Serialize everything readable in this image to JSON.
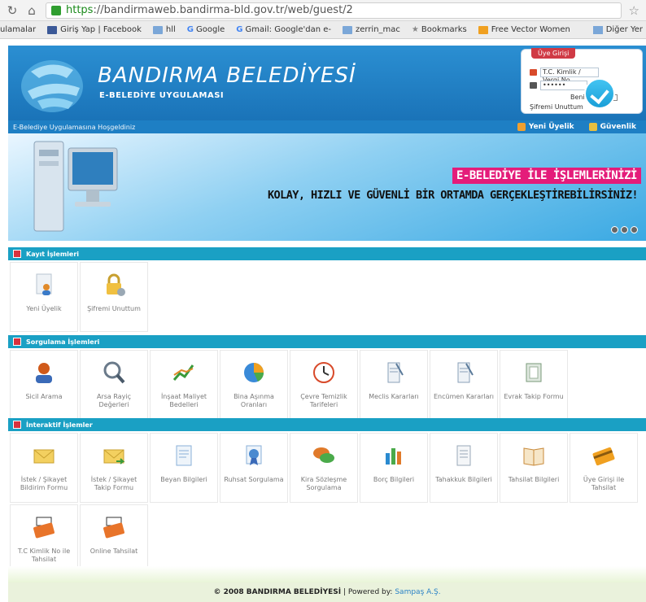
{
  "browser": {
    "nav_icons": [
      "back-icon",
      "home-icon"
    ],
    "url_https": "https",
    "url_rest": "://bandirmaweb.bandirma-bld.gov.tr/web/guest/2",
    "bookmarks": [
      {
        "label": "ulamalar",
        "color": "#f3f3f3"
      },
      {
        "label": "Giriş Yap | Facebook",
        "color": "#3b5998"
      },
      {
        "label": "hll",
        "color": "#7ba7d8"
      },
      {
        "label": "Google",
        "color": "#4285f4"
      },
      {
        "label": "Gmail: Google'dan e-",
        "color": "#4285f4"
      },
      {
        "label": "zerrin_mac",
        "color": "#7ba7d8"
      },
      {
        "label": "Bookmarks",
        "color": "#999999"
      },
      {
        "label": "Free Vector Women",
        "color": "#f0a020"
      }
    ],
    "bookmarks_other": "Diğer Yer"
  },
  "header": {
    "title": "BANDIRMA BELEDİYESİ",
    "subtitle": "E-BELEDİYE UYGULAMASI"
  },
  "login": {
    "tab": "Üye Girişi",
    "tc_label": "T.C. Kimlik / Vergi No",
    "password_value": "••••••",
    "remember_label": "Beni Hatırla",
    "forgot_label": "Şifremi Unuttum"
  },
  "nav": {
    "welcome": "E-Belediye Uygulamasına Hoşgeldiniz",
    "new_member": "Yeni Üyelik",
    "security": "Güvenlik"
  },
  "banner": {
    "headline": "E-BELEDİYE İLE İŞLEMLERİNİZİ",
    "tagline": "KOLAY, HIZLI VE GÜVENLİ BİR ORTAMDA GERÇEKLEŞTİREBİLİRSİNİZ!"
  },
  "sections": [
    {
      "title": "Kayıt İşlemleri",
      "items": [
        {
          "label": "Yeni Üyelik",
          "icon": "new-member-icon",
          "color": "#e08a2a"
        },
        {
          "label": "Şifremi Unuttum",
          "icon": "lock-icon",
          "color": "#f0c040"
        }
      ]
    },
    {
      "title": "Sorgulama İşlemleri",
      "items": [
        {
          "label": "Sicil Arama",
          "icon": "person-icon",
          "color": "#d05a1a"
        },
        {
          "label": "Arsa Rayiç Değerleri",
          "icon": "magnifier-icon",
          "color": "#6a7a8a"
        },
        {
          "label": "İnşaat Maliyet Bedelleri",
          "icon": "chart-icon",
          "color": "#3a9a3a"
        },
        {
          "label": "Bina Aşınma Oranları",
          "icon": "pie-chart-icon",
          "color": "#3a8ad8"
        },
        {
          "label": "Çevre Temizlik Tarifeleri",
          "icon": "clock-icon",
          "color": "#d84a2a"
        },
        {
          "label": "Meclis Kararları",
          "icon": "document-icon",
          "color": "#8aa0b8"
        },
        {
          "label": "Encümen Kararları",
          "icon": "document-icon",
          "color": "#8aa0b8"
        },
        {
          "label": "Evrak Takip Formu",
          "icon": "folder-icon",
          "color": "#7a9a7a"
        }
      ]
    },
    {
      "title": "İnteraktif İşlemler",
      "items": [
        {
          "label": "İstek / Şikayet Bildirim Formu",
          "icon": "envelope-icon",
          "color": "#e8c040"
        },
        {
          "label": "İstek / Şikayet Takip Formu",
          "icon": "envelope-arrow-icon",
          "color": "#e8c040"
        },
        {
          "label": "Beyan Bilgileri",
          "icon": "form-icon",
          "color": "#8ab0d8"
        },
        {
          "label": "Ruhsat Sorgulama",
          "icon": "certificate-icon",
          "color": "#4a8ad0"
        },
        {
          "label": "Kira Sözleşme Sorgulama",
          "icon": "speech-bubble-icon",
          "color": "#e07a2a"
        },
        {
          "label": "Borç Bilgileri",
          "icon": "bar-chart-icon",
          "color": "#2a8ad0"
        },
        {
          "label": "Tahakkuk Bilgileri",
          "icon": "receipt-icon",
          "color": "#9aa8b8"
        },
        {
          "label": "Tahsilat Bilgileri",
          "icon": "book-icon",
          "color": "#c88a3a"
        },
        {
          "label": "Üye Girişi ile Tahsilat",
          "icon": "credit-card-icon",
          "color": "#f0a020"
        }
      ]
    },
    {
      "title": "",
      "items": [
        {
          "label": "T.C Kimlik No ile Tahsilat",
          "icon": "id-card-payment-icon",
          "color": "#e8742a"
        },
        {
          "label": "Online Tahsilat",
          "icon": "online-payment-icon",
          "color": "#e8742a"
        }
      ]
    }
  ],
  "footer": {
    "copyright": "© 2008 BANDIRMA BELEDİYESİ",
    "separator": "|",
    "powered": "Powered by:",
    "powered_company": "Sampaş A.Ş."
  }
}
